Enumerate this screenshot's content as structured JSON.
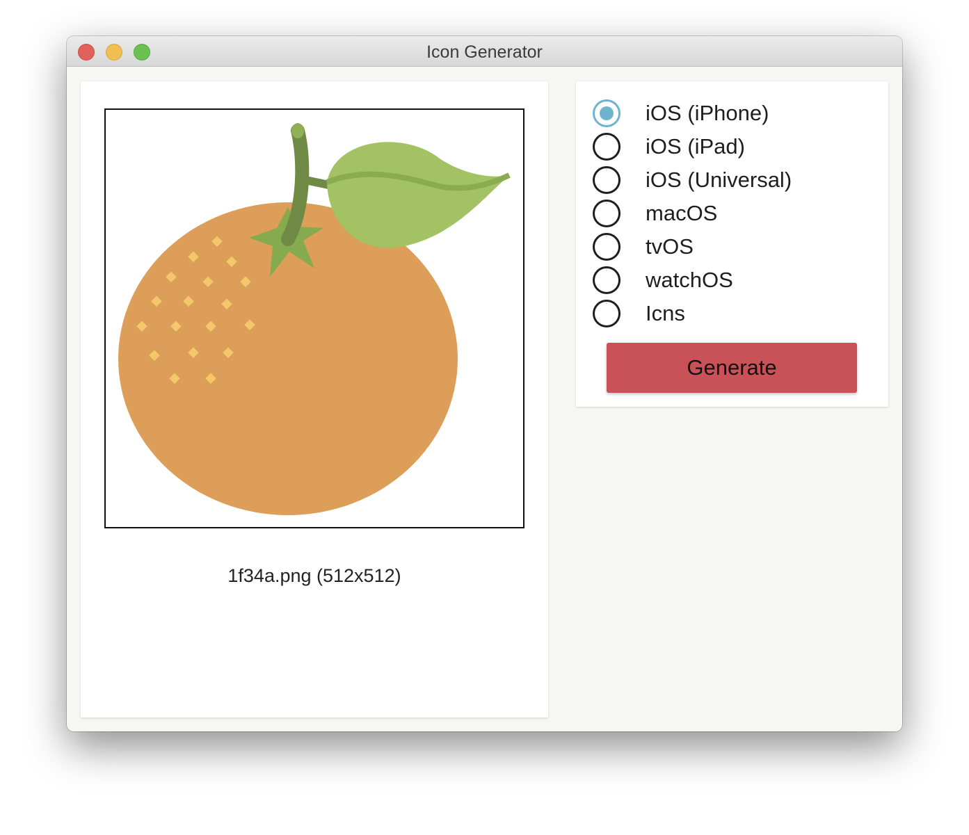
{
  "window": {
    "title": "Icon Generator"
  },
  "preview": {
    "file_caption": "1f34a.png (512x512)"
  },
  "platforms": {
    "selected": "iOS (iPhone)",
    "options": [
      {
        "label": "iOS (iPhone)",
        "selected": true
      },
      {
        "label": "iOS (iPad)",
        "selected": false
      },
      {
        "label": "iOS (Universal)",
        "selected": false
      },
      {
        "label": "macOS",
        "selected": false
      },
      {
        "label": "tvOS",
        "selected": false
      },
      {
        "label": "watchOS",
        "selected": false
      },
      {
        "label": "Icns",
        "selected": false
      }
    ]
  },
  "actions": {
    "generate_label": "Generate"
  },
  "colors": {
    "accent_radio": "#6fb3cf",
    "generate_button": "#c95258",
    "orange": "#dc9e58",
    "leaf": "#a3c263",
    "stem": "#6f8a45"
  }
}
